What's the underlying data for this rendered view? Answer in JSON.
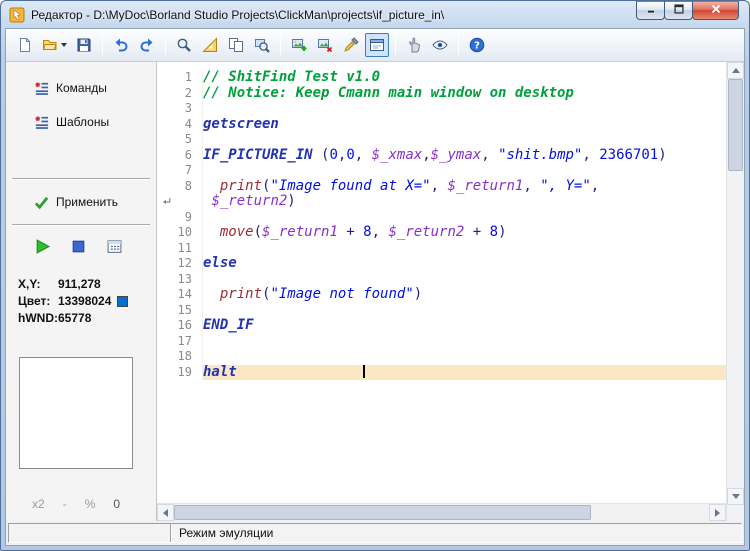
{
  "window": {
    "title": "Редактор - D:\\MyDoc\\Borland Studio Projects\\ClickMan\\projects\\if_picture_in\\",
    "app_icon": "app-icon",
    "controls": [
      {
        "icon": "minimize-icon"
      },
      {
        "icon": "maximize-icon"
      },
      {
        "icon": "close-icon"
      }
    ]
  },
  "toolbar": {
    "items": [
      {
        "icon": "new-file-icon"
      },
      {
        "icon": "open-folder-icon",
        "dropdown": true
      },
      {
        "icon": "save-icon"
      },
      {
        "sep": true
      },
      {
        "icon": "undo-icon"
      },
      {
        "icon": "redo-icon"
      },
      {
        "sep": true
      },
      {
        "icon": "zoom-icon"
      },
      {
        "icon": "ruler-icon"
      },
      {
        "icon": "copy-icon"
      },
      {
        "icon": "find-picture-icon"
      },
      {
        "sep": true
      },
      {
        "icon": "add-picture-icon"
      },
      {
        "icon": "picture-icon"
      },
      {
        "icon": "color-picker-icon"
      },
      {
        "icon": "window-toggle-icon",
        "pressed": true
      },
      {
        "sep": true
      },
      {
        "icon": "hand-icon"
      },
      {
        "icon": "eye-icon"
      },
      {
        "sep": true
      },
      {
        "icon": "help-icon"
      }
    ]
  },
  "sidebar": {
    "commands_label": "Команды",
    "templates_label": "Шаблоны",
    "apply_label": "Применить",
    "info": {
      "xy_label": "X,Y:",
      "xy_value": "911,278",
      "color_label": "Цвет:",
      "color_value": "13398024",
      "swatch_color": "#0870CC",
      "hwnd_label": "hWND:",
      "hwnd_value": "65778"
    },
    "zoom": {
      "x2": "x2",
      "dash": "-",
      "percent": "%",
      "value": "0"
    }
  },
  "editor": {
    "lines": [
      {
        "num": "1",
        "seg": [
          {
            "c": "cmt",
            "t": "// ShitFind Test v1.0"
          }
        ]
      },
      {
        "num": "2",
        "seg": [
          {
            "c": "cmt",
            "t": "// Notice: Keep Cmann main window on desktop"
          }
        ]
      },
      {
        "num": "3",
        "seg": []
      },
      {
        "num": "4",
        "seg": [
          {
            "c": "kw",
            "t": "getscreen"
          }
        ]
      },
      {
        "num": "5",
        "seg": []
      },
      {
        "num": "6",
        "seg": [
          {
            "c": "kw",
            "t": "IF_PICTURE_IN"
          },
          {
            "c": "pln",
            "t": " ("
          },
          {
            "c": "num",
            "t": "0"
          },
          {
            "c": "pln",
            "t": ","
          },
          {
            "c": "num",
            "t": "0"
          },
          {
            "c": "pln",
            "t": ", "
          },
          {
            "c": "var",
            "t": "$_xmax"
          },
          {
            "c": "pln",
            "t": ","
          },
          {
            "c": "var",
            "t": "$_ymax"
          },
          {
            "c": "pln",
            "t": ", "
          },
          {
            "c": "str",
            "t": "\"shit.bmp\""
          },
          {
            "c": "pln",
            "t": ", "
          },
          {
            "c": "num",
            "t": "2366701"
          },
          {
            "c": "pln",
            "t": ")"
          }
        ]
      },
      {
        "num": "7",
        "seg": []
      },
      {
        "num": "8",
        "seg": [
          {
            "c": "pln",
            "t": "  "
          },
          {
            "c": "fn",
            "t": "print"
          },
          {
            "c": "pln",
            "t": "("
          },
          {
            "c": "str",
            "t": "\"Image found at X=\""
          },
          {
            "c": "pln",
            "t": ", "
          },
          {
            "c": "var",
            "t": "$_return1"
          },
          {
            "c": "pln",
            "t": ", "
          },
          {
            "c": "str",
            "t": "\", Y=\""
          },
          {
            "c": "pln",
            "t": ","
          }
        ]
      },
      {
        "num": "",
        "wrap": true,
        "seg": [
          {
            "c": "pln",
            "t": " "
          },
          {
            "c": "var",
            "t": "$_return2"
          },
          {
            "c": "pln",
            "t": ")"
          }
        ]
      },
      {
        "num": "9",
        "seg": []
      },
      {
        "num": "10",
        "seg": [
          {
            "c": "pln",
            "t": "  "
          },
          {
            "c": "fn",
            "t": "move"
          },
          {
            "c": "pln",
            "t": "("
          },
          {
            "c": "var",
            "t": "$_return1"
          },
          {
            "c": "pln",
            "t": " + "
          },
          {
            "c": "num",
            "t": "8"
          },
          {
            "c": "pln",
            "t": ", "
          },
          {
            "c": "var",
            "t": "$_return2"
          },
          {
            "c": "pln",
            "t": " + "
          },
          {
            "c": "num",
            "t": "8"
          },
          {
            "c": "pln",
            "t": ")"
          }
        ]
      },
      {
        "num": "11",
        "seg": []
      },
      {
        "num": "12",
        "seg": [
          {
            "c": "kw",
            "t": "else"
          }
        ]
      },
      {
        "num": "13",
        "seg": []
      },
      {
        "num": "14",
        "seg": [
          {
            "c": "pln",
            "t": "  "
          },
          {
            "c": "fn",
            "t": "print"
          },
          {
            "c": "pln",
            "t": "("
          },
          {
            "c": "str",
            "t": "\"Image not found\""
          },
          {
            "c": "pln",
            "t": ")"
          }
        ]
      },
      {
        "num": "15",
        "seg": []
      },
      {
        "num": "16",
        "seg": [
          {
            "c": "kw",
            "t": "END_IF"
          }
        ]
      },
      {
        "num": "17",
        "seg": []
      },
      {
        "num": "18",
        "seg": []
      },
      {
        "num": "19",
        "hl": true,
        "cursor": true,
        "seg": [
          {
            "c": "kw",
            "t": "halt"
          },
          {
            "c": "pln",
            "t": "               "
          }
        ]
      }
    ]
  },
  "statusbar": {
    "text": "Режим эмуляции"
  }
}
